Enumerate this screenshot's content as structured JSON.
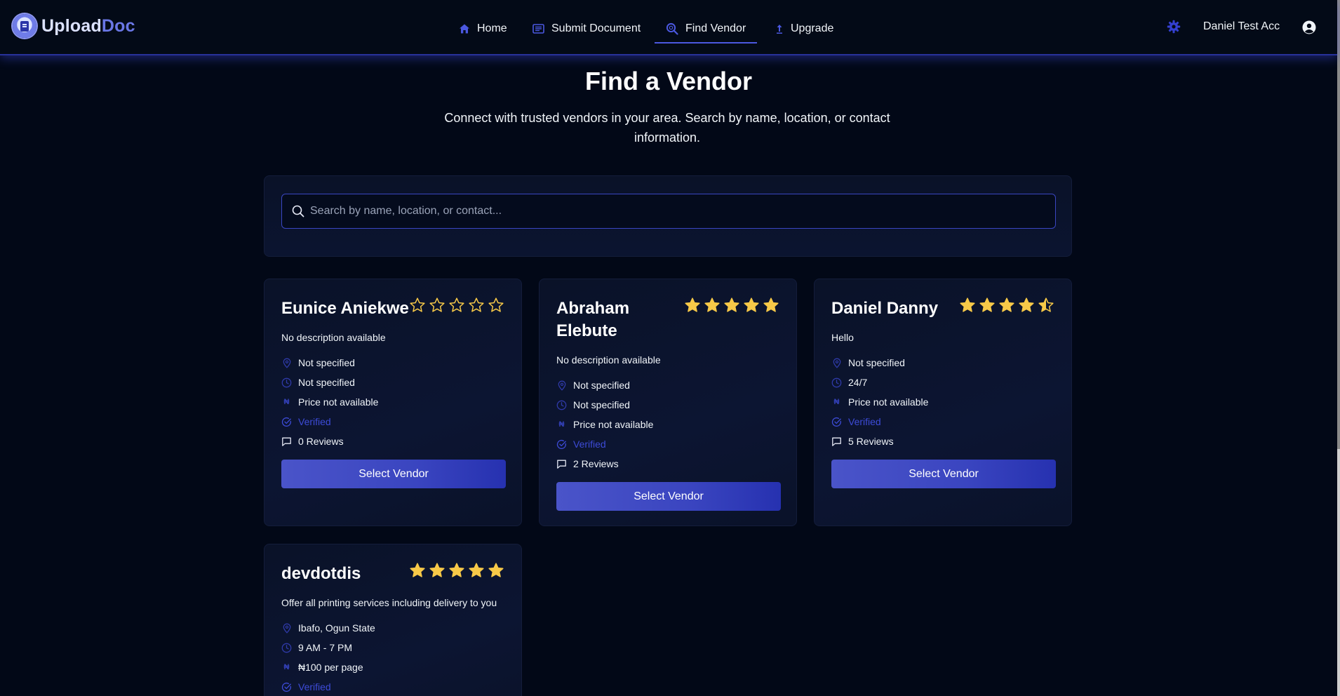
{
  "app": {
    "logo_part1": "Upload",
    "logo_part2": "Doc"
  },
  "nav": {
    "items": [
      {
        "label": "Home",
        "icon": "home-icon"
      },
      {
        "label": "Submit Document",
        "icon": "document-icon"
      },
      {
        "label": "Find Vendor",
        "icon": "search-icon",
        "active": true
      },
      {
        "label": "Upgrade",
        "icon": "upload-icon"
      }
    ],
    "settings_icon": "gear-icon",
    "user_name": "Daniel Test Acc",
    "user_icon": "user-circle-icon"
  },
  "hero": {
    "title": "Find a Vendor",
    "subtitle": "Connect with trusted vendors in your area. Search by name, location, or contact information."
  },
  "search": {
    "placeholder": "Search by name, location, or contact...",
    "value": ""
  },
  "colors": {
    "background": "#020817",
    "accent": "#4b58e0",
    "star": "#f7c948",
    "verified": "#3d4bd8"
  },
  "vendors": [
    {
      "name": "Eunice Aniekwe",
      "rating": 0,
      "description": "No description available",
      "location": "Not specified",
      "hours": "Not specified",
      "price": "Price not available",
      "verified_label": "Verified",
      "reviews": "0 Reviews",
      "button": "Select Vendor"
    },
    {
      "name": "Abraham Elebute",
      "rating": 5,
      "description": "No description available",
      "location": "Not specified",
      "hours": "Not specified",
      "price": "Price not available",
      "verified_label": "Verified",
      "reviews": "2 Reviews",
      "button": "Select Vendor"
    },
    {
      "name": "Daniel Danny",
      "rating": 4.5,
      "description": "Hello",
      "location": "Not specified",
      "hours": "24/7",
      "price": "Price not available",
      "verified_label": "Verified",
      "reviews": "5 Reviews",
      "button": "Select Vendor"
    },
    {
      "name": "devdotdis",
      "rating": 5,
      "description": "Offer all printing services including delivery to you",
      "location": "Ibafo, Ogun State",
      "hours": "9 AM - 7 PM",
      "price": "₦100 per page",
      "verified_label": "Verified"
    }
  ]
}
